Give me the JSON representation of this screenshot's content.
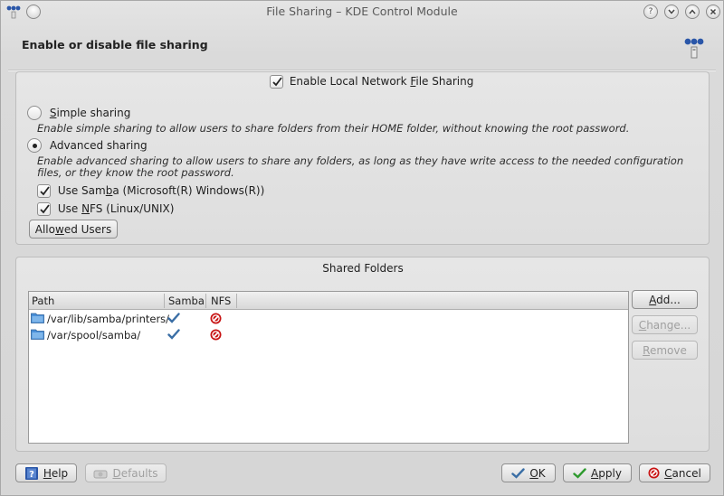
{
  "window": {
    "title": "File Sharing – KDE Control Module"
  },
  "header": {
    "title": "Enable or disable file sharing"
  },
  "sharing": {
    "enable_label_pre": "Enable Local Network ",
    "enable_label_ul": "F",
    "enable_label_post": "ile Sharing",
    "enable_checked": true,
    "simple_label_pre": "",
    "simple_label_ul": "S",
    "simple_label_post": "imple sharing",
    "simple_desc": "Enable simple sharing to allow users to share folders from their HOME folder, without knowing the root password.",
    "simple_selected": false,
    "advanced_label_pre": "Advanced sharin",
    "advanced_label_ul": "g",
    "advanced_label_post": "",
    "advanced_desc": "Enable advanced sharing to allow users to share any folders, as long as they have write access to the needed configuration files, or they know the root password.",
    "advanced_selected": true,
    "samba_label_pre": "Use Sam",
    "samba_label_ul": "b",
    "samba_label_post": "a (Microsoft(R) Windows(R))",
    "samba_checked": true,
    "nfs_label_pre": "Use ",
    "nfs_label_ul": "N",
    "nfs_label_post": "FS (Linux/UNIX)",
    "nfs_checked": true,
    "allowed_users_pre": "Allo",
    "allowed_users_ul": "w",
    "allowed_users_post": "ed Users"
  },
  "shared_folders": {
    "title": "Shared Folders",
    "columns": [
      "Path",
      "Samba",
      "NFS"
    ],
    "rows": [
      {
        "path": "/var/lib/samba/printers/",
        "samba": true,
        "nfs": false
      },
      {
        "path": "/var/spool/samba/",
        "samba": true,
        "nfs": false
      }
    ],
    "add_pre": "",
    "add_ul": "A",
    "add_post": "dd...",
    "change_pre": "",
    "change_ul": "C",
    "change_post": "hange...",
    "remove_pre": "",
    "remove_ul": "R",
    "remove_post": "emove",
    "change_enabled": false,
    "remove_enabled": false
  },
  "footer": {
    "help_pre": "",
    "help_ul": "H",
    "help_post": "elp",
    "defaults_pre": "",
    "defaults_ul": "D",
    "defaults_post": "efaults",
    "defaults_enabled": false,
    "ok_pre": "",
    "ok_ul": "O",
    "ok_post": "K",
    "apply_pre": "",
    "apply_ul": "A",
    "apply_post": "pply",
    "cancel_pre": "",
    "cancel_ul": "C",
    "cancel_post": "ancel"
  },
  "colors": {
    "check_blue": "#3a6ea5",
    "nfs_red": "#c81414",
    "folder_blue": "#4a90d9",
    "ok_green": "#2e9a2e",
    "cancel_red": "#c81414"
  },
  "icons": [
    "app-icon",
    "pin-icon",
    "help-titlebar-icon",
    "minimize-icon",
    "maximize-icon",
    "close-icon",
    "network-icon",
    "folder-icon",
    "check-icon",
    "cancel-icon",
    "help-icon",
    "defaults-icon",
    "ok-icon",
    "apply-icon"
  ]
}
